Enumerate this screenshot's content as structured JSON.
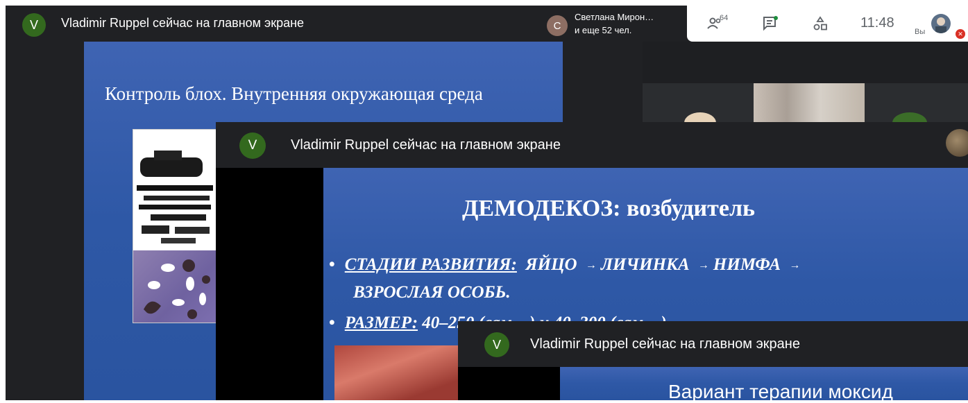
{
  "share_banner": {
    "avatar_letter": "V",
    "text": "Vladimir Ruppel сейчас на главном экране"
  },
  "topbar": {
    "presenter": {
      "avatar_letter": "С",
      "name": "Светлана Мирон…",
      "others": "и еще 52 чел."
    },
    "participants_count": "64",
    "time": "11:48",
    "you_label": "Вы",
    "icons": [
      "people-icon",
      "chat-icon",
      "activities-icon",
      "mic-off-icon"
    ],
    "colors": {
      "chat_dot": "#1e8e3e",
      "mic_off": "#d93025"
    }
  },
  "slide1": {
    "title": "Контроль блох.  Внутренняя  окружающая среда"
  },
  "slide2": {
    "title": "ДЕМОДЕКОЗ: возбудитель",
    "bullet1_label": "СТАДИИ РАЗВИТИЯ:",
    "stages": [
      "ЯЙЦО",
      "ЛИЧИНКА",
      "НИМФА"
    ],
    "bullet1_cont": "ВЗРОСЛАЯ ОСОБЬ.",
    "bullet2_label": "РАЗМЕР:",
    "bullet2_value": "40–250 (сам…) и 40–300 (сам…) …"
  },
  "slide3": {
    "title": "Вариант  терапии  моксид"
  },
  "colors": {
    "meet_dark": "#202124",
    "avatar_green": "#33691e",
    "slide_blue": "#2e58a6"
  }
}
